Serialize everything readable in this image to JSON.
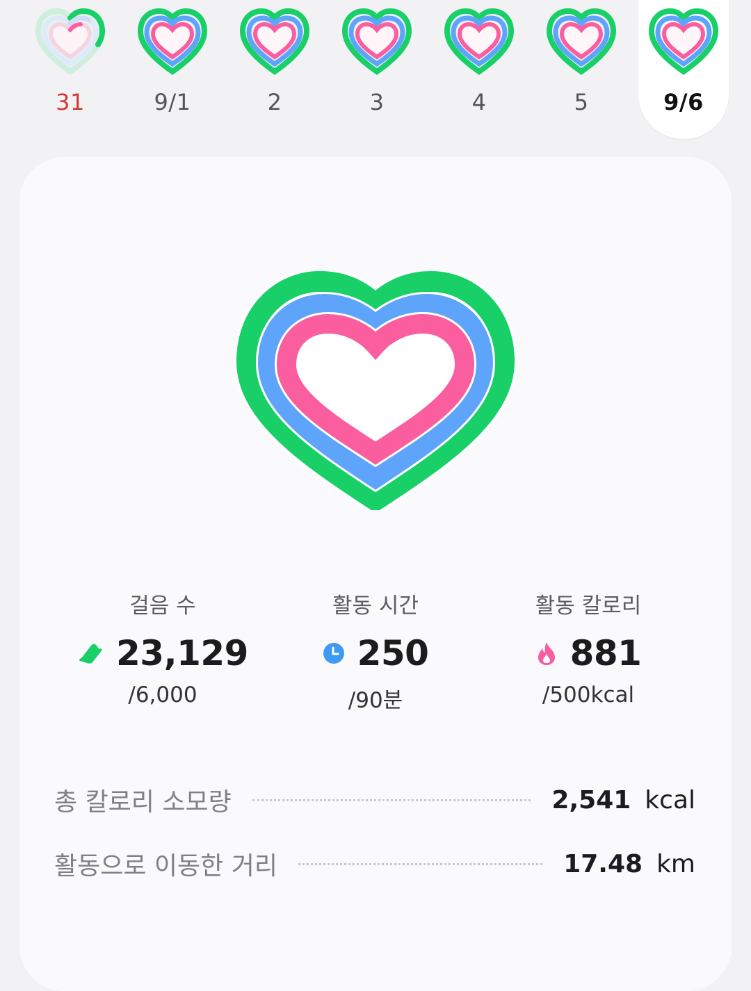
{
  "week": {
    "days": [
      {
        "label": "31",
        "sunday": true,
        "progress": 0.7
      },
      {
        "label": "9/1",
        "progress": 1
      },
      {
        "label": "2",
        "progress": 1
      },
      {
        "label": "3",
        "progress": 1
      },
      {
        "label": "4",
        "progress": 1
      },
      {
        "label": "5",
        "progress": 1
      },
      {
        "label": "9/6",
        "selected": true,
        "progress": 1
      }
    ]
  },
  "summary": {
    "ring_colors": {
      "steps": "#19cf68",
      "active_time": "#5ea4fb",
      "calories": "#fa5e9f"
    },
    "steps": {
      "title": "걸음 수",
      "value": "23,129",
      "goal": "/6,000",
      "icon": "shoe-icon"
    },
    "active_time": {
      "title": "활동 시간",
      "value": "250",
      "goal": "/90분",
      "icon": "clock-icon"
    },
    "calories": {
      "title": "활동 칼로리",
      "value": "881",
      "goal": "/500kcal",
      "icon": "flame-icon"
    }
  },
  "details": {
    "total_calories": {
      "label": "총 칼로리 소모량",
      "value": "2,541",
      "unit": "kcal"
    },
    "distance": {
      "label": "활동으로 이동한 거리",
      "value": "17.48",
      "unit": "km"
    }
  }
}
